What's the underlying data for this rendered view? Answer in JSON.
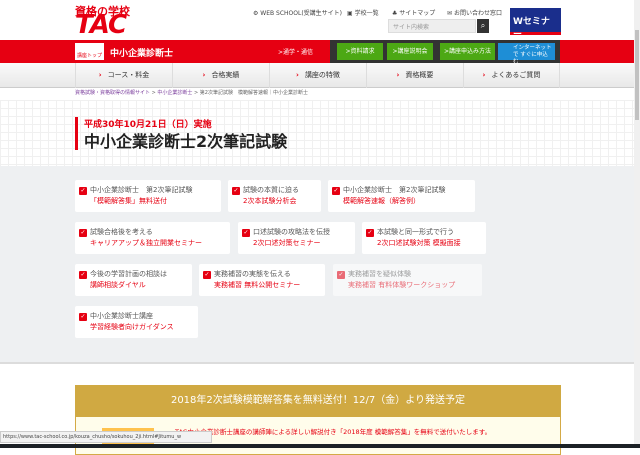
{
  "header": {
    "logo_small": "資格の学校",
    "logo_big": "TAC",
    "links": [
      "WEB SCHOOL(受講生サイト)",
      "学校一覧",
      "サイトマップ",
      "お問い合わせ窓口"
    ],
    "search_placeholder": "サイト内検索",
    "wseminar": "Wセミナー"
  },
  "redbar": {
    "top_icon": "講座トップ",
    "course": "中小企業診断士",
    "tsugaku": ">通学・通信",
    "buttons": [
      ">資料請求",
      ">講座説明会",
      ">講座申込み方法"
    ],
    "internet": "インターネットで すぐに申込む"
  },
  "nav": [
    "コース・料金",
    "合格実績",
    "講座の特徴",
    "資格概要",
    "よくあるご質問"
  ],
  "breadcrumb": {
    "links": [
      "資格試験・資格取得の情報サイト",
      "中小企業診断士"
    ],
    "rest": "第2次筆記試験　模範解答速報｜中小企業診断士"
  },
  "title": {
    "date": "平成30年10月21日（日）実施",
    "main": "中小企業診断士2次筆記試験"
  },
  "cards": [
    {
      "title": "中小企業診断士　第2次筆記試験",
      "sub": "「模範解答集」無料送付"
    },
    {
      "title": "試験の本質に迫る",
      "sub": "2次本試験分析会"
    },
    {
      "title": "中小企業診断士　第2次筆記試験",
      "sub": "模範解答速報（解答例）"
    },
    {
      "title": "試験合格後を考える",
      "sub": "キャリアアップ＆独立開業セミナー"
    },
    {
      "title": "口述試験の攻略法を伝授",
      "sub": "2次口述対策セミナー"
    },
    {
      "title": "本試験と同一形式で行う",
      "sub": "2次口述試験対策 模擬面接"
    },
    {
      "title": "今後の学習計画の相談は",
      "sub": "講師相談ダイヤル"
    },
    {
      "title": "実務補習の実態を伝える",
      "sub": "実務補習 無料公開セミナー"
    },
    {
      "title": "実務補習を疑似体験",
      "sub": "実務補習 有料体験ワークショップ"
    },
    {
      "title": "中小企業診断士講座",
      "sub": "学習経験者向けガイダンス"
    }
  ],
  "banner": {
    "heading": "2018年2次試験模範解答集を無料送付！12/7（金）より発送予定",
    "desc": "TAC中小企業診断士講座の講師陣による詳しい解説付き「2018年度 模範解答集」を無料で送付いたします。"
  },
  "status_url": "https://www.tac-school.co.jp/kouza_chusho/sokuhou_2ji.html#Jitumu_w"
}
